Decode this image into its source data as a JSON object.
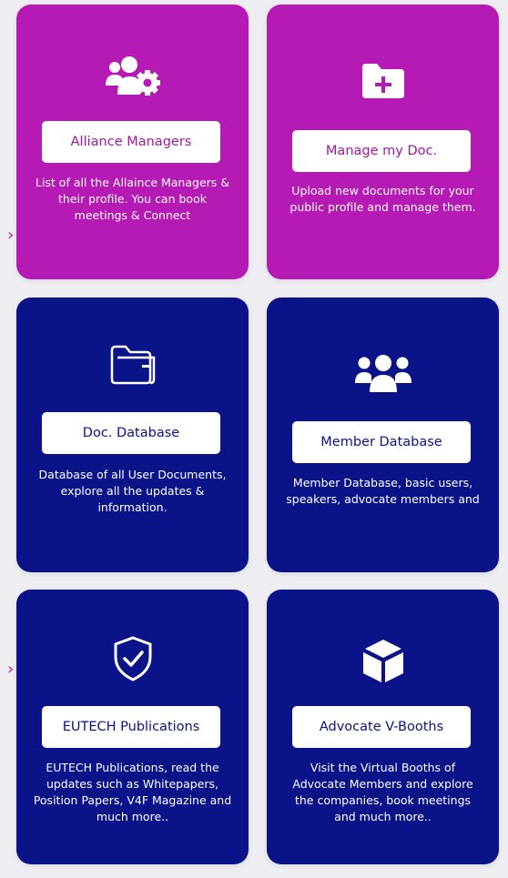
{
  "colors": {
    "magenta": "#b51ab4",
    "navy": "#0a1387",
    "background": "#eeeef2"
  },
  "side_arrows": [
    "›",
    "›"
  ],
  "cards": [
    {
      "title": "Alliance Managers",
      "icon": "users-gear-icon",
      "description": "List of all the Allaince Managers & their profile. You can book meetings & Connect"
    },
    {
      "title": "Manage my Doc.",
      "icon": "folder-plus-icon",
      "description": "Upload new documents for your public profile and manage them."
    },
    {
      "title": "Doc. Database",
      "icon": "folder-icon",
      "description": "Database of all User Documents, explore all the updates & information."
    },
    {
      "title": "Member Database",
      "icon": "users-icon",
      "description": "Member Database, basic users, speakers, advocate members and"
    },
    {
      "title": "EUTECH Publications",
      "icon": "shield-check-icon",
      "description": "EUTECH Publications, read the updates such as Whitepapers, Position Papers, V4F Magazine and much more.."
    },
    {
      "title": "Advocate V-Booths",
      "icon": "cube-icon",
      "description": "Visit the Virtual Booths of Advocate Members and explore the companies, book meetings and much more.."
    }
  ]
}
